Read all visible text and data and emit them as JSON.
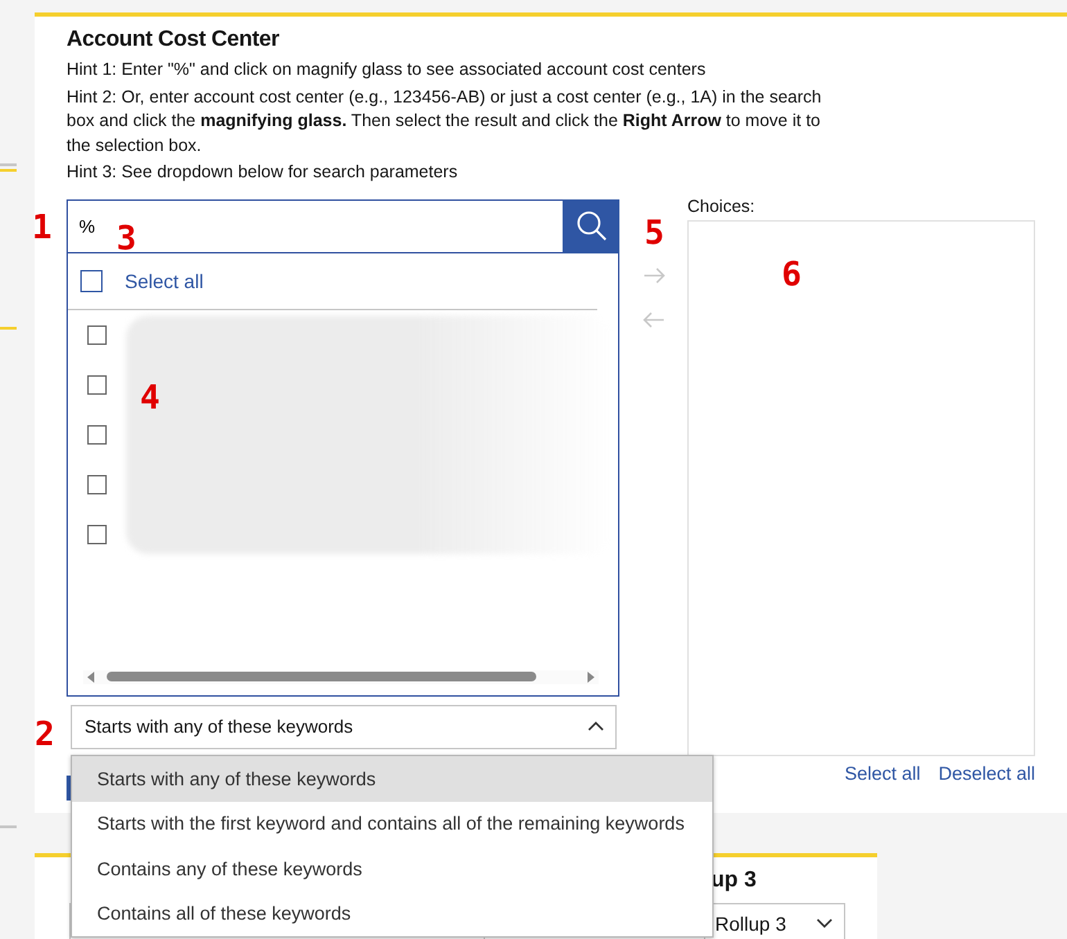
{
  "panel": {
    "title": "Account Cost Center",
    "hints": [
      "Hint 1: Enter \"%\" and click on magnify glass to see associated account cost centers",
      "Hint 2: Or, enter account cost center (e.g., 123456-AB) or just a cost center (e.g., 1A) in the search box and click the **magnifying glass.** Then select the result and click the **Right Arrow** to move it to the selection box.",
      "Hint 3: See dropdown below for search parameters"
    ]
  },
  "search": {
    "value": "%"
  },
  "results": {
    "select_all": {
      "label": "Select all",
      "checked": false
    },
    "rows": [
      {
        "checked": false
      },
      {
        "checked": false
      },
      {
        "checked": false
      },
      {
        "checked": false
      },
      {
        "checked": false
      }
    ]
  },
  "match_mode": {
    "value": "Starts with any of these keywords",
    "expanded": true,
    "options": [
      {
        "label": "Starts with any of these keywords",
        "selected": true
      },
      {
        "label": "Starts with the first keyword and contains all of the remaining keywords",
        "selected": false
      },
      {
        "label": "Contains any of these keywords",
        "selected": false
      },
      {
        "label": "Contains all of these keywords",
        "selected": false
      }
    ]
  },
  "transfer": [
    {
      "kind": "add",
      "disabled": true
    },
    {
      "kind": "remove",
      "disabled": true
    }
  ],
  "choices": {
    "label": "Choices:",
    "links": [
      "Select all",
      "Deselect all"
    ]
  },
  "annotations": [
    "1",
    "2",
    "3",
    "4",
    "5",
    "6"
  ],
  "lower_panel": {
    "title_right": "up 3",
    "select": {
      "value": "Rollup 3"
    }
  }
}
